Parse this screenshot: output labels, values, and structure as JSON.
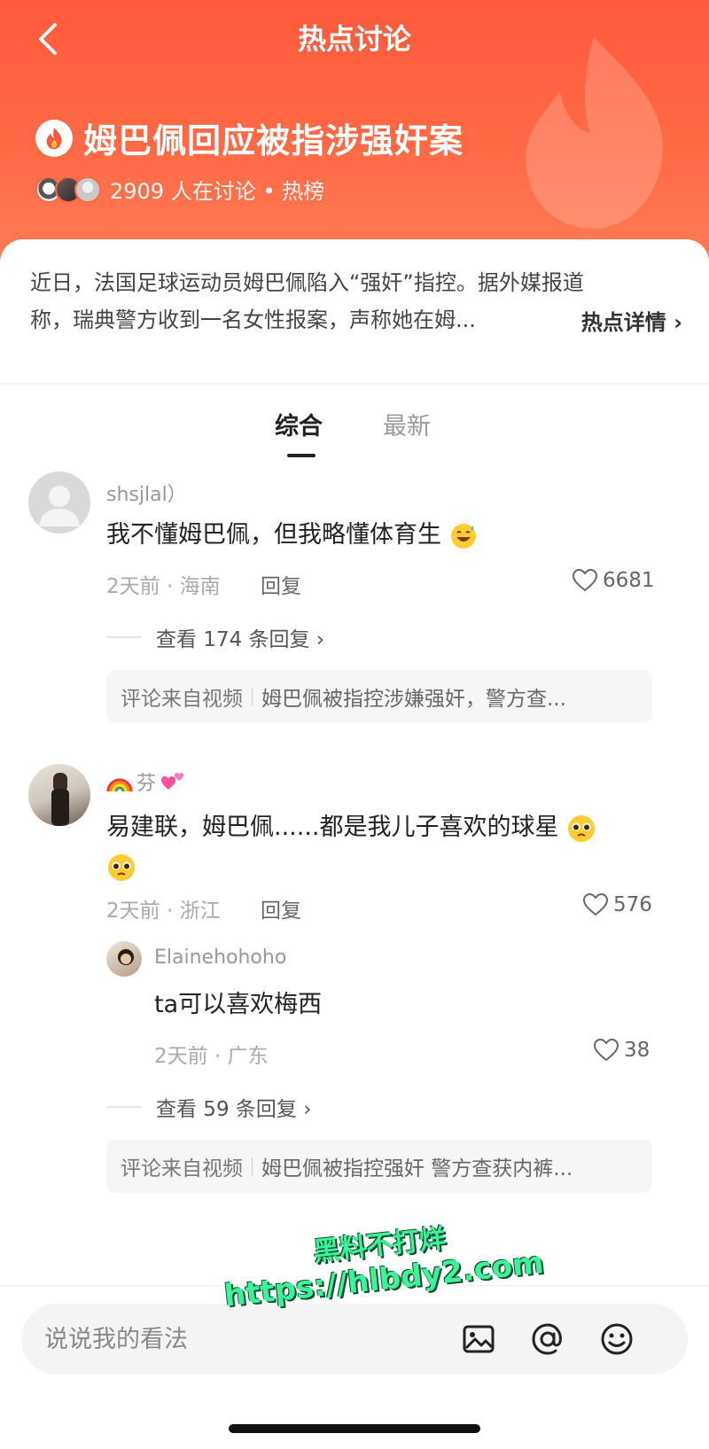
{
  "header": {
    "nav_title": "热点讨论",
    "topic_title": "姆巴佩回应被指涉强奸案",
    "meta": "2909 人在讨论 • 热榜"
  },
  "summary": {
    "line1": "近日，法国足球运动员姆巴佩陷入“强奸”指控。据外媒报道",
    "line2": "称，瑞典警方收到一名女性报案，声称她在姆...",
    "detail_link": "热点详情 ›"
  },
  "tabs": [
    {
      "label": "综合",
      "active": true
    },
    {
      "label": "最新",
      "active": false
    }
  ],
  "comments": [
    {
      "username": "shsjlal）",
      "content": "我不懂姆巴佩，但我略懂体育生",
      "emoji": "grinning-sweat",
      "time_location": "2天前 · 海南",
      "reply_label": "回复",
      "likes": "6681",
      "view_replies": "查看 174 条回复 ›",
      "source_label": "评论来自视频",
      "source_title": "姆巴佩被指控涉嫌强奸，警方查..."
    },
    {
      "username": "芬",
      "username_emojis": [
        "rainbow",
        "revolving-hearts"
      ],
      "content_line1": "易建联，姆巴佩......都是我儿子喜欢的球星",
      "emoji": "pleading-face",
      "time_location": "2天前 · 浙江",
      "reply_label": "回复",
      "likes": "576",
      "sub_reply": {
        "username": "Elainehohoho",
        "content": "ta可以喜欢梅西",
        "time_location": "2天前 · 广东",
        "likes": "38"
      },
      "view_replies": "查看 59 条回复 ›",
      "source_label": "评论来自视频",
      "source_title": "姆巴佩被指控强奸 警方查获内裤..."
    }
  ],
  "bottom_bar": {
    "placeholder": "说说我的看法"
  },
  "watermark": {
    "line1": "黑料不打烊",
    "line2": "https://hlbdy2.com"
  },
  "colors": {
    "header_accent": "#ff5a3c",
    "watermark": "#3cf29a"
  }
}
